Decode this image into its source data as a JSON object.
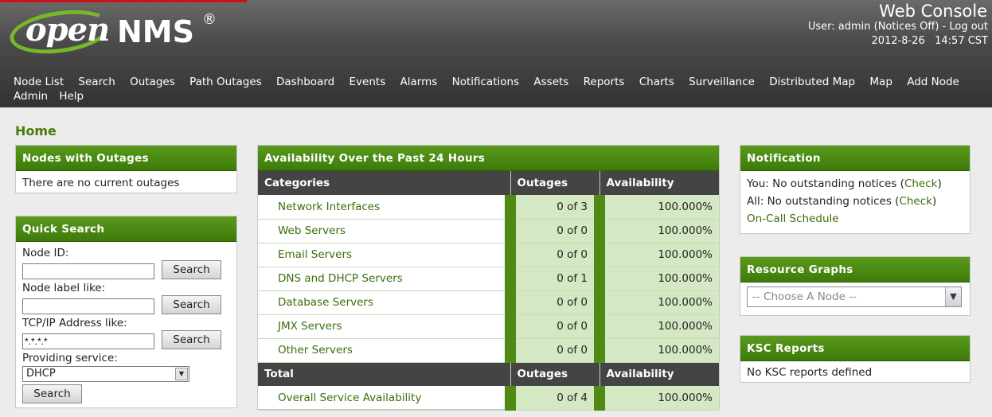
{
  "header": {
    "app_title": "Web Console",
    "user_line": "User: admin (Notices Off) - Log out",
    "date": "2012-8-26",
    "time": "14:57 CST",
    "logo_open": "open",
    "logo_nms": "NMS",
    "logo_reg": "®"
  },
  "nav": {
    "items": [
      "Node List",
      "Search",
      "Outages",
      "Path Outages",
      "Dashboard",
      "Events",
      "Alarms",
      "Notifications",
      "Assets",
      "Reports",
      "Charts",
      "Surveillance",
      "Distributed Map",
      "Map",
      "Add Node",
      "Admin",
      "Help"
    ]
  },
  "page": {
    "title": "Home"
  },
  "outages_box": {
    "title": "Nodes with Outages",
    "text": "There are no current outages"
  },
  "quick_search": {
    "title": "Quick Search",
    "node_id_label": "Node ID:",
    "node_label_label": "Node label like:",
    "ip_label": "TCP/IP Address like:",
    "ip_value": "*.*.*.*",
    "service_label": "Providing service:",
    "service_value": "DHCP",
    "search_label": "Search"
  },
  "availability": {
    "title": "Availability Over the Past 24 Hours",
    "col_categories": "Categories",
    "col_outages": "Outages",
    "col_availability": "Availability",
    "rows": [
      {
        "name": "Network Interfaces",
        "outages": "0 of 3",
        "availability": "100.000%"
      },
      {
        "name": "Web Servers",
        "outages": "0 of 0",
        "availability": "100.000%"
      },
      {
        "name": "Email Servers",
        "outages": "0 of 0",
        "availability": "100.000%"
      },
      {
        "name": "DNS and DHCP Servers",
        "outages": "0 of 1",
        "availability": "100.000%"
      },
      {
        "name": "Database Servers",
        "outages": "0 of 0",
        "availability": "100.000%"
      },
      {
        "name": "JMX Servers",
        "outages": "0 of 0",
        "availability": "100.000%"
      },
      {
        "name": "Other Servers",
        "outages": "0 of 0",
        "availability": "100.000%"
      }
    ],
    "total_label": "Total",
    "total_row": {
      "name": "Overall Service Availability",
      "outages": "0 of 4",
      "availability": "100.000%"
    }
  },
  "notification": {
    "title": "Notification",
    "you_text": "You: No outstanding notices (",
    "all_text": "All: No outstanding notices (",
    "check_label": "Check",
    "close_paren": ")",
    "oncall_label": "On-Call Schedule"
  },
  "resource_graphs": {
    "title": "Resource Graphs",
    "placeholder": "-- Choose A Node --"
  },
  "ksc": {
    "title": "KSC Reports",
    "text": "No KSC reports defined"
  },
  "colors": {
    "accent_green": "#3d7a0a",
    "header_dark": "#333333",
    "link_green": "#3a6e08"
  },
  "icons": [
    "chevron-down-icon",
    "dropdown-arrow-icon"
  ]
}
